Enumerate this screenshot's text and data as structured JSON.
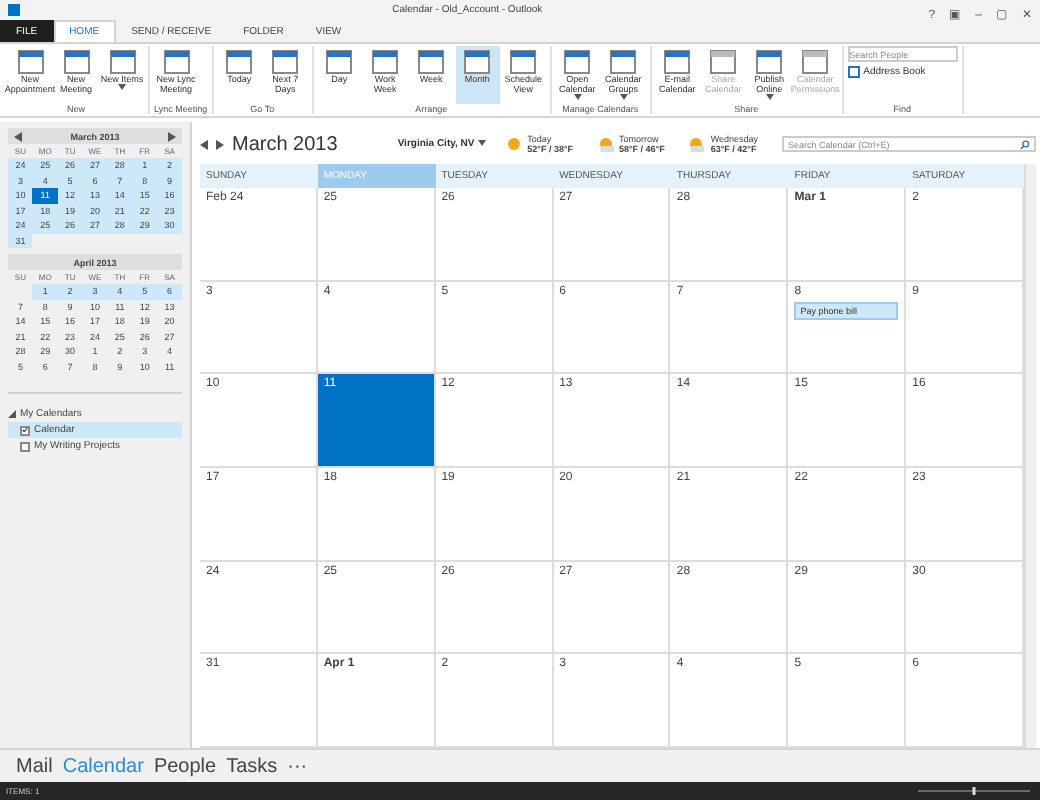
{
  "window": {
    "title": "Calendar - Old_Account - Outlook",
    "controls": [
      "?",
      "▣",
      "–",
      "▢",
      "✕"
    ]
  },
  "tabs": [
    {
      "label": "FILE",
      "selected": false,
      "kind": "file"
    },
    {
      "label": "HOME",
      "selected": true,
      "kind": "tab"
    },
    {
      "label": "SEND / RECEIVE",
      "selected": false,
      "kind": "tab"
    },
    {
      "label": "FOLDER",
      "selected": false,
      "kind": "tab"
    },
    {
      "label": "VIEW",
      "selected": false,
      "kind": "tab"
    }
  ],
  "ribbon": [
    {
      "label": "New",
      "buttons": [
        {
          "label": "New Appointment",
          "menu": false,
          "disabled": false,
          "selected": false
        },
        {
          "label": "New Meeting",
          "menu": false,
          "disabled": false,
          "selected": false
        },
        {
          "label": "New Items",
          "menu": true,
          "disabled": false,
          "selected": false
        }
      ]
    },
    {
      "label": "Lync Meeting",
      "buttons": [
        {
          "label": "New Lync Meeting",
          "menu": false,
          "disabled": false,
          "selected": false
        }
      ]
    },
    {
      "label": "Go To",
      "buttons": [
        {
          "label": "Today",
          "menu": false,
          "disabled": false,
          "selected": false
        },
        {
          "label": "Next 7 Days",
          "menu": false,
          "disabled": false,
          "selected": false
        }
      ]
    },
    {
      "label": "Arrange",
      "buttons": [
        {
          "label": "Day",
          "menu": false,
          "disabled": false,
          "selected": false
        },
        {
          "label": "Work Week",
          "menu": false,
          "disabled": false,
          "selected": false
        },
        {
          "label": "Week",
          "menu": false,
          "disabled": false,
          "selected": false
        },
        {
          "label": "Month",
          "menu": false,
          "disabled": false,
          "selected": true
        },
        {
          "label": "Schedule View",
          "menu": false,
          "disabled": false,
          "selected": false
        }
      ]
    },
    {
      "label": "Manage Calendars",
      "buttons": [
        {
          "label": "Open Calendar",
          "menu": true,
          "disabled": false,
          "selected": false
        },
        {
          "label": "Calendar Groups",
          "menu": true,
          "disabled": false,
          "selected": false
        }
      ]
    },
    {
      "label": "Share",
      "buttons": [
        {
          "label": "E-mail Calendar",
          "menu": false,
          "disabled": false,
          "selected": false
        },
        {
          "label": "Share Calendar",
          "menu": false,
          "disabled": true,
          "selected": false
        },
        {
          "label": "Publish Online",
          "menu": true,
          "disabled": false,
          "selected": false
        },
        {
          "label": "Calendar Permissions",
          "menu": false,
          "disabled": true,
          "selected": false
        }
      ]
    }
  ],
  "find": {
    "label": "Find",
    "search": {
      "placeholder": "Search People"
    },
    "address_book": "Address Book"
  },
  "mini_calendars": [
    {
      "title": "March 2013",
      "nav": true,
      "weekdays": [
        "SU",
        "MO",
        "TU",
        "WE",
        "TH",
        "FR",
        "SA"
      ],
      "weeks": [
        [
          {
            "day": "24",
            "in_view": true,
            "selected": false
          },
          {
            "day": "25",
            "in_view": true,
            "selected": false
          },
          {
            "day": "26",
            "in_view": true,
            "selected": false
          },
          {
            "day": "27",
            "in_view": true,
            "selected": false
          },
          {
            "day": "28",
            "in_view": true,
            "selected": false
          },
          {
            "day": "1",
            "in_view": true,
            "selected": false
          },
          {
            "day": "2",
            "in_view": true,
            "selected": false
          }
        ],
        [
          {
            "day": "3",
            "in_view": true,
            "selected": false
          },
          {
            "day": "4",
            "in_view": true,
            "selected": false
          },
          {
            "day": "5",
            "in_view": true,
            "selected": false
          },
          {
            "day": "6",
            "in_view": true,
            "selected": false
          },
          {
            "day": "7",
            "in_view": true,
            "selected": false
          },
          {
            "day": "8",
            "in_view": true,
            "selected": false
          },
          {
            "day": "9",
            "in_view": true,
            "selected": false
          }
        ],
        [
          {
            "day": "10",
            "in_view": true,
            "selected": false
          },
          {
            "day": "11",
            "in_view": true,
            "selected": true
          },
          {
            "day": "12",
            "in_view": true,
            "selected": false
          },
          {
            "day": "13",
            "in_view": true,
            "selected": false
          },
          {
            "day": "14",
            "in_view": true,
            "selected": false
          },
          {
            "day": "15",
            "in_view": true,
            "selected": false
          },
          {
            "day": "16",
            "in_view": true,
            "selected": false
          }
        ],
        [
          {
            "day": "17",
            "in_view": true,
            "selected": false
          },
          {
            "day": "18",
            "in_view": true,
            "selected": false
          },
          {
            "day": "19",
            "in_view": true,
            "selected": false
          },
          {
            "day": "20",
            "in_view": true,
            "selected": false
          },
          {
            "day": "21",
            "in_view": true,
            "selected": false
          },
          {
            "day": "22",
            "in_view": true,
            "selected": false
          },
          {
            "day": "23",
            "in_view": true,
            "selected": false
          }
        ],
        [
          {
            "day": "24",
            "in_view": true,
            "selected": false
          },
          {
            "day": "25",
            "in_view": true,
            "selected": false
          },
          {
            "day": "26",
            "in_view": true,
            "selected": false
          },
          {
            "day": "27",
            "in_view": true,
            "selected": false
          },
          {
            "day": "28",
            "in_view": true,
            "selected": false
          },
          {
            "day": "29",
            "in_view": true,
            "selected": false
          },
          {
            "day": "30",
            "in_view": true,
            "selected": false
          }
        ],
        [
          {
            "day": "31",
            "in_view": true,
            "selected": false
          }
        ]
      ]
    },
    {
      "title": "April 2013",
      "nav": false,
      "weekdays": [
        "SU",
        "MO",
        "TU",
        "WE",
        "TH",
        "FR",
        "SA"
      ],
      "weeks": [
        [
          {
            "in_view": false,
            "selected": false
          },
          {
            "day": "1",
            "in_view": true,
            "selected": false
          },
          {
            "day": "2",
            "in_view": true,
            "selected": false
          },
          {
            "day": "3",
            "in_view": true,
            "selected": false
          },
          {
            "day": "4",
            "in_view": true,
            "selected": false
          },
          {
            "day": "5",
            "in_view": true,
            "selected": false
          },
          {
            "day": "6",
            "in_view": true,
            "selected": false
          }
        ],
        [
          {
            "day": "7",
            "in_view": false,
            "selected": false
          },
          {
            "day": "8",
            "in_view": false,
            "selected": false
          },
          {
            "day": "9",
            "in_view": false,
            "selected": false
          },
          {
            "day": "10",
            "in_view": false,
            "selected": false
          },
          {
            "day": "11",
            "in_view": false,
            "selected": false
          },
          {
            "day": "12",
            "in_view": false,
            "selected": false
          },
          {
            "day": "13",
            "in_view": false,
            "selected": false
          }
        ],
        [
          {
            "day": "14",
            "in_view": false,
            "selected": false
          },
          {
            "day": "15",
            "in_view": false,
            "selected": false
          },
          {
            "day": "16",
            "in_view": false,
            "selected": false
          },
          {
            "day": "17",
            "in_view": false,
            "selected": false
          },
          {
            "day": "18",
            "in_view": false,
            "selected": false
          },
          {
            "day": "19",
            "in_view": false,
            "selected": false
          },
          {
            "day": "20",
            "in_view": false,
            "selected": false
          }
        ],
        [
          {
            "day": "21",
            "in_view": false,
            "selected": false
          },
          {
            "day": "22",
            "in_view": false,
            "selected": false
          },
          {
            "day": "23",
            "in_view": false,
            "selected": false
          },
          {
            "day": "24",
            "in_view": false,
            "selected": false
          },
          {
            "day": "25",
            "in_view": false,
            "selected": false
          },
          {
            "day": "26",
            "in_view": false,
            "selected": false
          },
          {
            "day": "27",
            "in_view": false,
            "selected": false
          }
        ],
        [
          {
            "day": "28",
            "in_view": false,
            "selected": false
          },
          {
            "day": "29",
            "in_view": false,
            "selected": false
          },
          {
            "day": "30",
            "in_view": false,
            "selected": false
          },
          {
            "day": "1",
            "in_view": false,
            "selected": false
          },
          {
            "day": "2",
            "in_view": false,
            "selected": false
          },
          {
            "day": "3",
            "in_view": false,
            "selected": false
          },
          {
            "day": "4",
            "in_view": false,
            "selected": false
          }
        ],
        [
          {
            "day": "5",
            "in_view": false,
            "selected": false
          },
          {
            "day": "6",
            "in_view": false,
            "selected": false
          },
          {
            "day": "7",
            "in_view": false,
            "selected": false
          },
          {
            "day": "8",
            "in_view": false,
            "selected": false
          },
          {
            "day": "9",
            "in_view": false,
            "selected": false
          },
          {
            "day": "10",
            "in_view": false,
            "selected": false
          },
          {
            "day": "11",
            "in_view": false,
            "selected": false
          }
        ]
      ]
    }
  ],
  "folders": {
    "label": "My Calendars",
    "expanded": true,
    "children": [
      {
        "label": "Calendar",
        "checked": true,
        "selected": true
      },
      {
        "label": "My Writing Projects",
        "checked": false,
        "selected": false
      }
    ]
  },
  "calendar": {
    "title": "March 2013",
    "location": "Virginia City, NV",
    "weather": [
      {
        "day": "Today",
        "temps": "52°F / 38°F"
      },
      {
        "day": "Tomorrow",
        "temps": "58°F / 46°F"
      },
      {
        "day": "Wednesday",
        "temps": "63°F / 42°F"
      }
    ],
    "search": {
      "placeholder": "Search Calendar (Ctrl+E)"
    },
    "weekdays": [
      {
        "label": "SUNDAY",
        "selected": false
      },
      {
        "label": "MONDAY",
        "selected": true
      },
      {
        "label": "TUESDAY",
        "selected": false
      },
      {
        "label": "WEDNESDAY",
        "selected": false
      },
      {
        "label": "THURSDAY",
        "selected": false
      },
      {
        "label": "FRIDAY",
        "selected": false
      },
      {
        "label": "SATURDAY",
        "selected": false
      }
    ],
    "weeks": [
      [
        {
          "date": "Feb 24",
          "bold": false,
          "selected": false
        },
        {
          "date": "25",
          "bold": false,
          "selected": false
        },
        {
          "date": "26",
          "bold": false,
          "selected": false
        },
        {
          "date": "27",
          "bold": false,
          "selected": false
        },
        {
          "date": "28",
          "bold": false,
          "selected": false
        },
        {
          "date": "Mar 1",
          "bold": true,
          "selected": false
        },
        {
          "date": "2",
          "bold": false,
          "selected": false
        }
      ],
      [
        {
          "date": "3",
          "bold": false,
          "selected": false
        },
        {
          "date": "4",
          "bold": false,
          "selected": false
        },
        {
          "date": "5",
          "bold": false,
          "selected": false
        },
        {
          "date": "6",
          "bold": false,
          "selected": false
        },
        {
          "date": "7",
          "bold": false,
          "selected": false
        },
        {
          "date": "8",
          "bold": false,
          "selected": false,
          "events": [
            "Pay phone bill"
          ]
        },
        {
          "date": "9",
          "bold": false,
          "selected": false
        }
      ],
      [
        {
          "date": "10",
          "bold": false,
          "selected": false
        },
        {
          "date": "11",
          "bold": false,
          "selected": true
        },
        {
          "date": "12",
          "bold": false,
          "selected": false
        },
        {
          "date": "13",
          "bold": false,
          "selected": false
        },
        {
          "date": "14",
          "bold": false,
          "selected": false
        },
        {
          "date": "15",
          "bold": false,
          "selected": false
        },
        {
          "date": "16",
          "bold": false,
          "selected": false
        }
      ],
      [
        {
          "date": "17",
          "bold": false,
          "selected": false
        },
        {
          "date": "18",
          "bold": false,
          "selected": false
        },
        {
          "date": "19",
          "bold": false,
          "selected": false
        },
        {
          "date": "20",
          "bold": false,
          "selected": false
        },
        {
          "date": "21",
          "bold": false,
          "selected": false
        },
        {
          "date": "22",
          "bold": false,
          "selected": false
        },
        {
          "date": "23",
          "bold": false,
          "selected": false
        }
      ],
      [
        {
          "date": "24",
          "bold": false,
          "selected": false
        },
        {
          "date": "25",
          "bold": false,
          "selected": false
        },
        {
          "date": "26",
          "bold": false,
          "selected": false
        },
        {
          "date": "27",
          "bold": false,
          "selected": false
        },
        {
          "date": "28",
          "bold": false,
          "selected": false
        },
        {
          "date": "29",
          "bold": false,
          "selected": false
        },
        {
          "date": "30",
          "bold": false,
          "selected": false
        }
      ],
      [
        {
          "date": "31",
          "bold": false,
          "selected": false
        },
        {
          "date": "Apr 1",
          "bold": true,
          "selected": false
        },
        {
          "date": "2",
          "bold": false,
          "selected": false
        },
        {
          "date": "3",
          "bold": false,
          "selected": false
        },
        {
          "date": "4",
          "bold": false,
          "selected": false
        },
        {
          "date": "5",
          "bold": false,
          "selected": false
        },
        {
          "date": "6",
          "bold": false,
          "selected": false
        }
      ]
    ]
  },
  "nav": [
    {
      "label": "Mail",
      "selected": false
    },
    {
      "label": "Calendar",
      "selected": true
    },
    {
      "label": "People",
      "selected": false
    },
    {
      "label": "Tasks",
      "selected": false
    },
    {
      "label": "···",
      "selected": false
    }
  ],
  "status_bar": {
    "text": "ITEMS: 1",
    "zoom": {
      "level": 0.5
    }
  }
}
